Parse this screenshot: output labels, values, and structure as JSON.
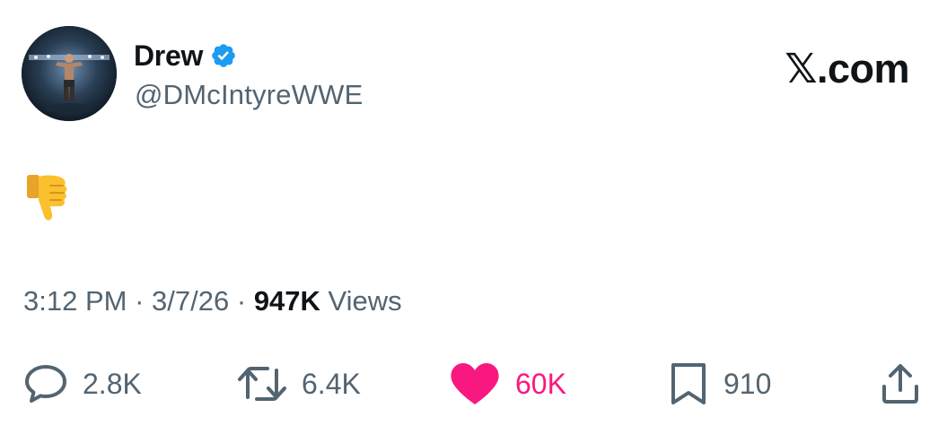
{
  "author": {
    "display_name": "Drew",
    "handle": "@DMcIntyreWWE",
    "verified": true
  },
  "brand": {
    "label": "𝕏.com"
  },
  "tweet": {
    "content_emoji_icon": "thumbs-down-emoji"
  },
  "meta": {
    "time": "3:12 PM",
    "date": "3/7/26",
    "separator": "·",
    "views_count": "947K",
    "views_label": "Views"
  },
  "actions": {
    "replies": "2.8K",
    "reposts": "6.4K",
    "likes": "60K",
    "bookmarks": "910"
  },
  "colors": {
    "text_primary": "#0f1419",
    "text_secondary": "#536471",
    "verified_blue": "#1d9bf0",
    "like_pink": "#f91880"
  }
}
